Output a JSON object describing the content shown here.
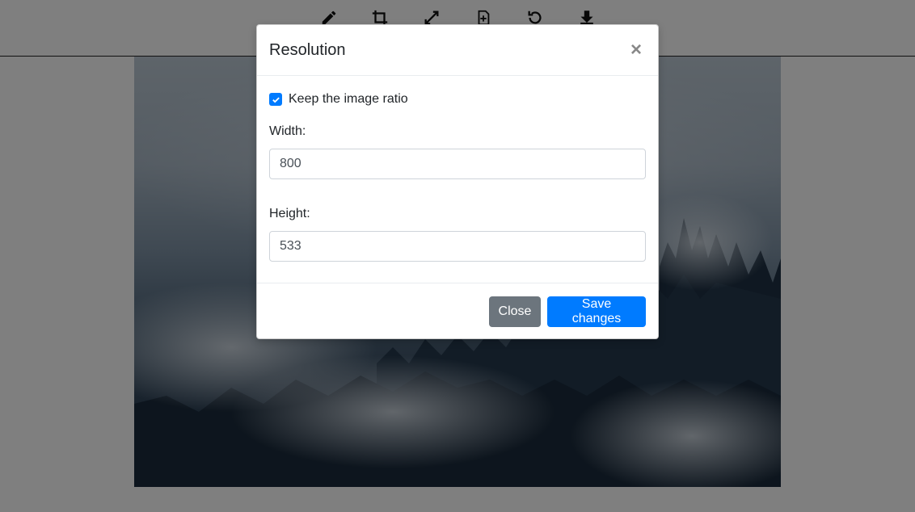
{
  "toolbar": {
    "tools": [
      {
        "icon": "pencil-icon"
      },
      {
        "icon": "crop-icon"
      },
      {
        "icon": "resize-icon"
      },
      {
        "icon": "add-file-icon"
      },
      {
        "icon": "rotate-icon"
      },
      {
        "icon": "download-icon"
      }
    ]
  },
  "image": {
    "description_icon": "foggy-forest-image"
  },
  "modal": {
    "title": "Resolution",
    "close_symbol": "×",
    "keep_ratio_label": "Keep the image ratio",
    "keep_ratio_checked": true,
    "width_label": "Width:",
    "width_value": "800",
    "height_label": "Height:",
    "height_value": "533",
    "close_button": "Close",
    "save_button": "Save changes"
  },
  "colors": {
    "primary": "#007bff",
    "secondary": "#6c757d"
  }
}
